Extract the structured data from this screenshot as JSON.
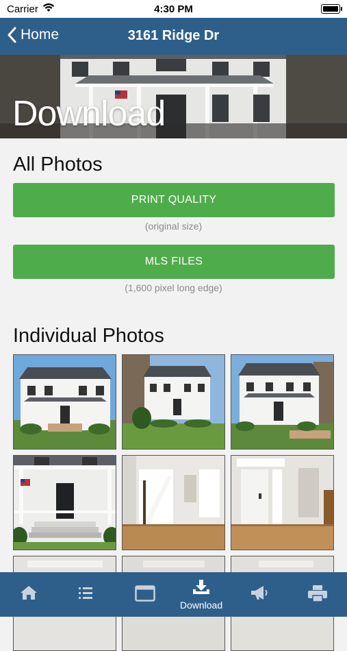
{
  "status": {
    "carrier": "Carrier",
    "time": "4:30 PM"
  },
  "nav": {
    "back_label": "Home",
    "title": "3161 Ridge Dr"
  },
  "hero": {
    "title": "Download"
  },
  "all_photos": {
    "heading": "All Photos",
    "print_button": "PRINT QUALITY",
    "print_note": "(original size)",
    "mls_button": "MLS FILES",
    "mls_note": "(1,600 pixel long edge)"
  },
  "individual": {
    "heading": "Individual Photos"
  },
  "tabs": [
    {
      "icon": "home-icon",
      "label": ""
    },
    {
      "icon": "list-icon",
      "label": ""
    },
    {
      "icon": "browser-window-icon",
      "label": ""
    },
    {
      "icon": "download-icon",
      "label": "Download",
      "active": true
    },
    {
      "icon": "megaphone-icon",
      "label": ""
    },
    {
      "icon": "printer-icon",
      "label": ""
    }
  ],
  "colors": {
    "nav": "#2e5f8a",
    "button": "#4fac4a",
    "background": "#f2f2f2"
  }
}
